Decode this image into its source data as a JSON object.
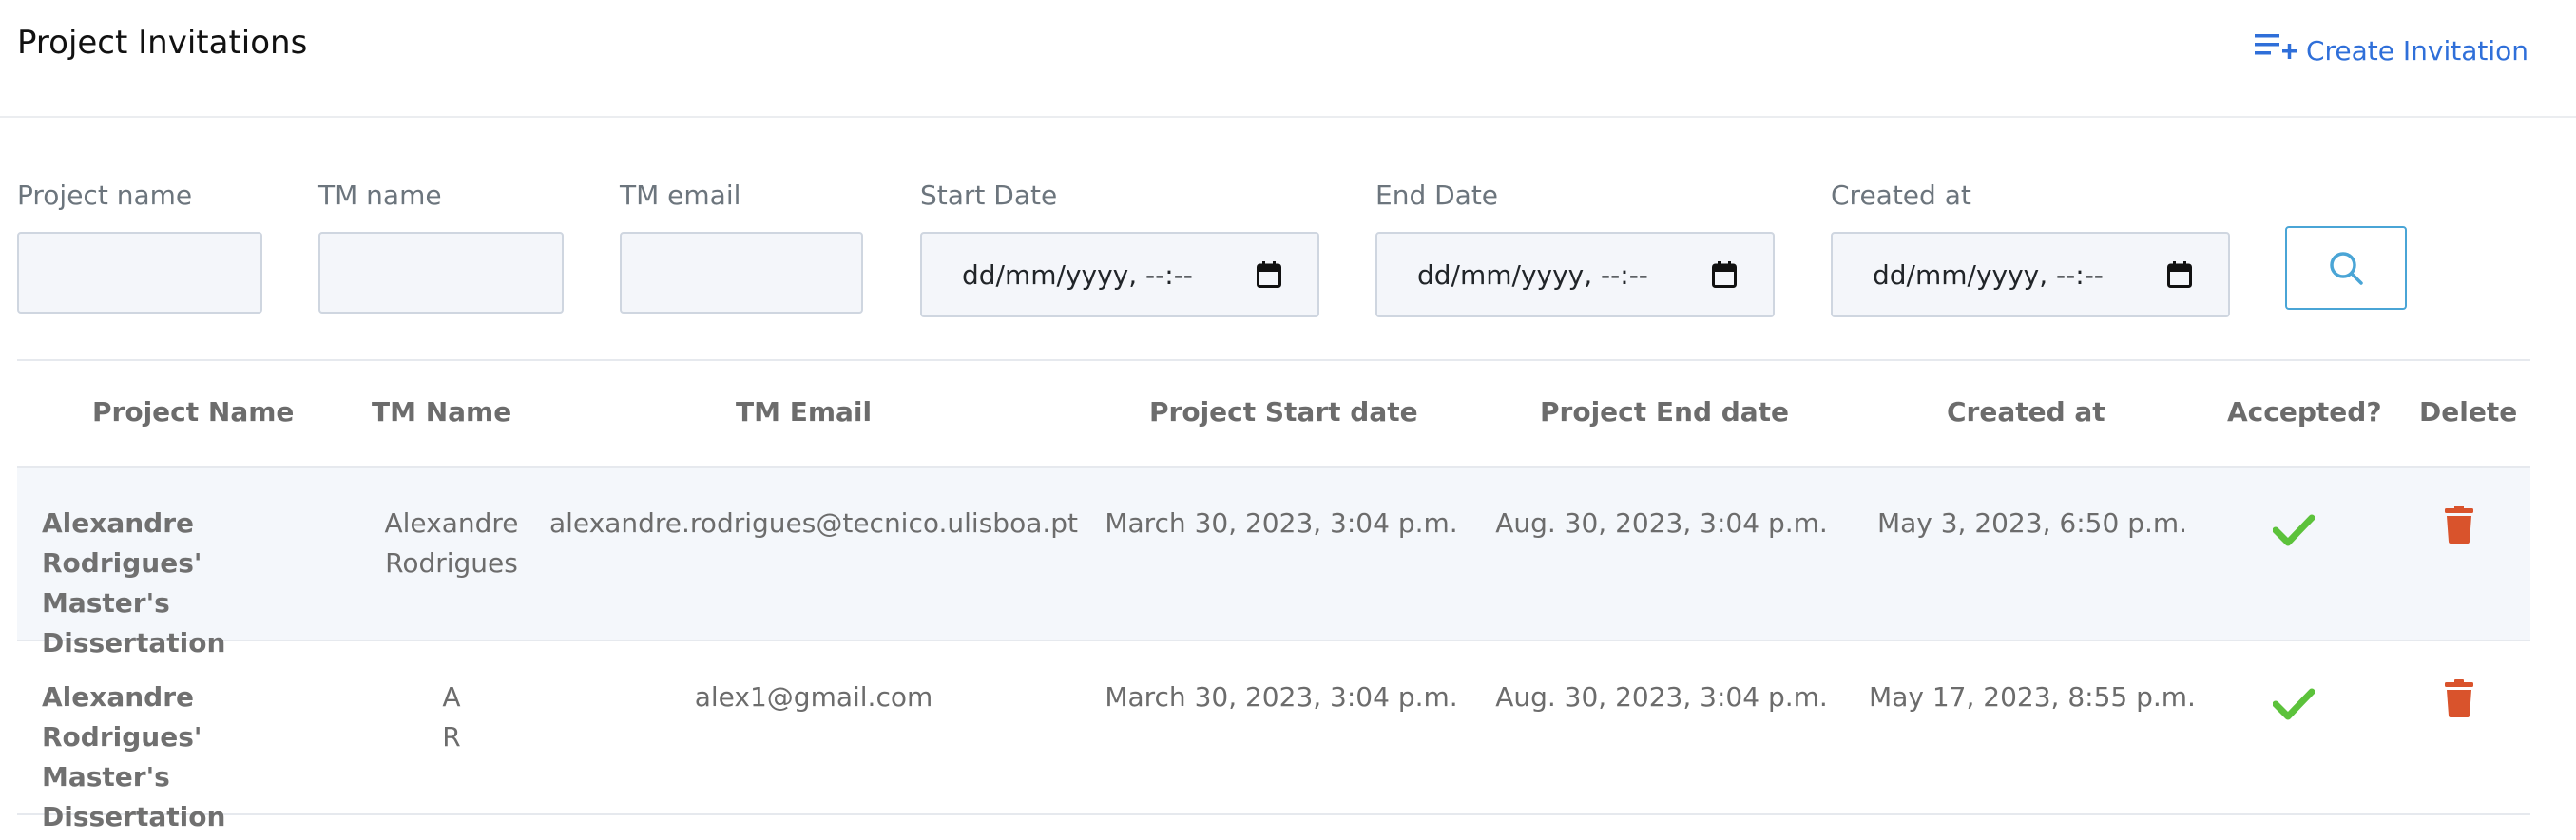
{
  "header": {
    "title": "Project Invitations",
    "create_button": {
      "label": "Create Invitation",
      "icon": "playlist-add-icon"
    }
  },
  "filters": {
    "project_name": {
      "label": "Project name",
      "value": ""
    },
    "tm_name": {
      "label": "TM name",
      "value": ""
    },
    "tm_email": {
      "label": "TM email",
      "value": ""
    },
    "start_date": {
      "label": "Start Date",
      "placeholder": "dd/mm/yyyy, --:--"
    },
    "end_date": {
      "label": "End Date",
      "placeholder": "dd/mm/yyyy, --:--"
    },
    "created_at": {
      "label": "Created at",
      "placeholder": "dd/mm/yyyy, --:--"
    },
    "search_icon": "search-icon"
  },
  "table": {
    "headers": {
      "project_name": "Project Name",
      "tm_name": "TM Name",
      "tm_email": "TM Email",
      "start_date": "Project Start date",
      "end_date": "Project End date",
      "created_at": "Created at",
      "accepted": "Accepted?",
      "delete": "Delete"
    },
    "rows": [
      {
        "project_line1": "Alexandre Rodrigues'",
        "project_line2": "Master's Dissertation",
        "tm_name_line1": "Alexandre",
        "tm_name_line2": "Rodrigues",
        "tm_email": "alexandre.rodrigues@tecnico.ulisboa.pt",
        "start_date": "March 30, 2023, 3:04 p.m.",
        "end_date": "Aug. 30, 2023, 3:04 p.m.",
        "created_at": "May 3, 2023, 6:50 p.m.",
        "accepted": true
      },
      {
        "project_line1": "Alexandre Rodrigues'",
        "project_line2": "Master's Dissertation",
        "tm_name_line1": "A",
        "tm_name_line2": "R",
        "tm_email": "alex1@gmail.com",
        "start_date": "March 30, 2023, 3:04 p.m.",
        "end_date": "Aug. 30, 2023, 3:04 p.m.",
        "created_at": "May 17, 2023, 8:55 p.m.",
        "accepted": true
      }
    ]
  },
  "colors": {
    "accent_blue": "#2f6fd9",
    "search_border": "#4aa5d6",
    "accepted_green": "#5cc23b",
    "delete_red": "#d9532c"
  }
}
